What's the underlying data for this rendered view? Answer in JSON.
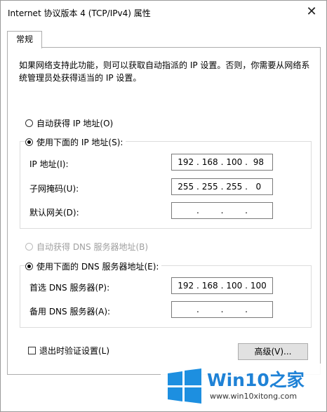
{
  "window": {
    "title": "Internet 协议版本 4 (TCP/IPv4) 属性",
    "close_glyph": "✕"
  },
  "tabs": [
    {
      "label": "常规"
    }
  ],
  "description": "如果网络支持此功能，则可以获取自动指派的 IP 设置。否则，你需要从网络系统管理员处获得适当的 IP 设置。",
  "ip": {
    "auto_label": "自动获得 IP 地址(O)",
    "manual_label": "使用下面的 IP 地址(S):",
    "manual_selected": true,
    "address_label": "IP 地址(I):",
    "address": [
      "192",
      "168",
      "100",
      "98"
    ],
    "subnet_label": "子网掩码(U):",
    "subnet": [
      "255",
      "255",
      "255",
      "0"
    ],
    "gateway_label": "默认网关(D):",
    "gateway": [
      "",
      "",
      "",
      ""
    ]
  },
  "dns": {
    "auto_label": "自动获得 DNS 服务器地址(B)",
    "auto_disabled": true,
    "manual_label": "使用下面的 DNS 服务器地址(E):",
    "manual_selected": true,
    "preferred_label": "首选 DNS 服务器(P):",
    "preferred": [
      "192",
      "168",
      "100",
      "100"
    ],
    "alternate_label": "备用 DNS 服务器(A):",
    "alternate": [
      "",
      "",
      "",
      ""
    ]
  },
  "validate_label": "退出时验证设置(L)",
  "validate_checked": false,
  "advanced_label": "高级(V)...",
  "watermark": {
    "brand": "Win10之家",
    "url": "www.win10xitong.com",
    "colors": {
      "brand": "#1f82d6",
      "logo": "#1d8fe0"
    }
  }
}
